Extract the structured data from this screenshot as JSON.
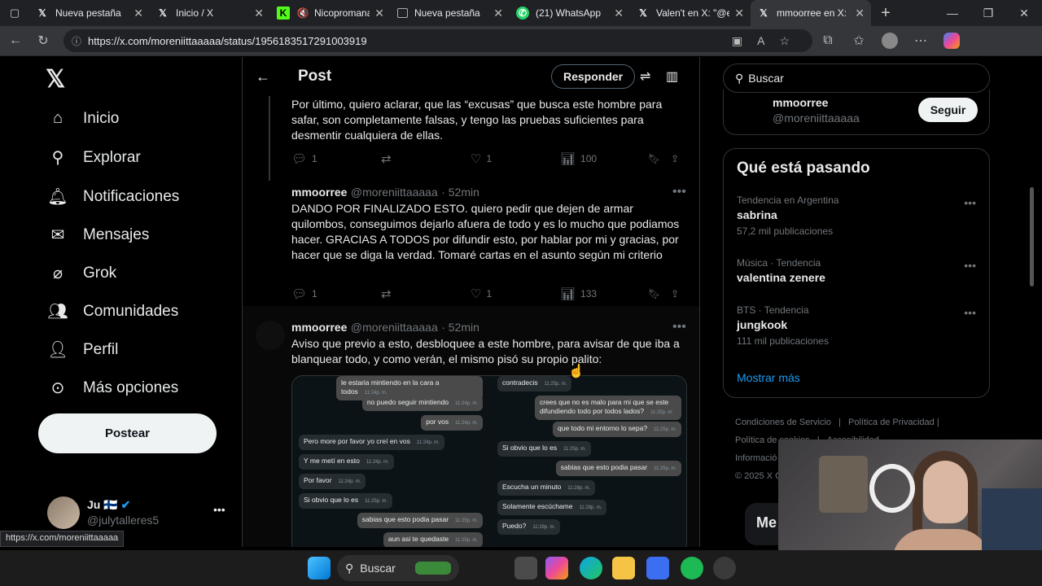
{
  "browser": {
    "tabs": [
      {
        "icon": "x-logo-icon",
        "title": "Nueva pestaña"
      },
      {
        "icon": "x-logo-icon",
        "title": "Inicio / X"
      },
      {
        "icon": "kick-logo-icon",
        "title": "Nicopromana"
      },
      {
        "icon": "tab-icon",
        "title": "Nueva pestaña"
      },
      {
        "icon": "whatsapp-icon",
        "title": "(21) WhatsApp"
      },
      {
        "icon": "x-logo-icon",
        "title": "Valen't en X: \"@e"
      },
      {
        "icon": "x-logo-icon",
        "title": "mmoorree en X: \""
      }
    ],
    "url": "https://x.com/moreniittaaaaa/status/1956183517291003919",
    "status_url": "https://x.com/moreniittaaaaa"
  },
  "sidebar": {
    "items": [
      {
        "label": "Inicio",
        "icon": "home-icon"
      },
      {
        "label": "Explorar",
        "icon": "search-icon"
      },
      {
        "label": "Notificaciones",
        "icon": "bell-icon"
      },
      {
        "label": "Mensajes",
        "icon": "mail-icon"
      },
      {
        "label": "Grok",
        "icon": "grok-icon"
      },
      {
        "label": "Comunidades",
        "icon": "people-icon"
      },
      {
        "label": "Perfil",
        "icon": "person-icon"
      },
      {
        "label": "Más opciones",
        "icon": "more-icon"
      }
    ],
    "post_button": "Postear",
    "account": {
      "name": "Ju 🇫🇮",
      "handle": "@julytalleres5"
    }
  },
  "main": {
    "title": "Post",
    "reply_button": "Responder",
    "tweets": [
      {
        "text": "Por último, quiero aclarar, que las “excusas” que busca este hombre para safar, son completamente falsas, y tengo las pruebas suficientes para desmentir cualquiera de ellas.",
        "replies": "1",
        "retweets": "",
        "likes": "1",
        "views": "100"
      },
      {
        "name": "mmoorree",
        "handle": "@moreniittaaaaa",
        "time": "· 52min",
        "text": "DANDO POR FINALIZADO ESTO. quiero pedir que dejen de armar quilombos, conseguimos dejarlo afuera de todo y es lo mucho que podiamos hacer. GRACIAS A TODOS por difundir esto, por hablar por mi y gracias, por hacer que se diga la verdad. Tomaré cartas en el asunto según mi criterio",
        "replies": "1",
        "retweets": "",
        "likes": "1",
        "views": "133"
      },
      {
        "name": "mmoorree",
        "handle": "@moreniittaaaaa",
        "time": "· 52min",
        "text": "Aviso que previo a esto, desbloquee a este hombre, para avisar de que iba a blanquear todo, y como verán, el mismo pisó su propio palito:"
      }
    ],
    "chat_left": [
      {
        "text": "le estaria mintiendo en la cara a todos",
        "time": "11:24p. m.",
        "side": "out"
      },
      {
        "text": "no puedo seguir mintiendo",
        "time": "11:24p. m.",
        "side": "out"
      },
      {
        "text": "por vos",
        "time": "11:24p. m.",
        "side": "out"
      },
      {
        "text": "Pero more por favor yo creí en vos",
        "time": "11:24p. m.",
        "side": "in"
      },
      {
        "text": "Y me metí en esto",
        "time": "11:24p. m.",
        "side": "in"
      },
      {
        "text": "Por favor",
        "time": "11:24p. m.",
        "side": "in"
      },
      {
        "text": "Si obvio que lo es",
        "time": "11:25p. m.",
        "side": "in"
      },
      {
        "text": "sabias que esto podia pasar",
        "time": "11:25p. m.",
        "side": "out"
      },
      {
        "text": "aun asi te quedaste",
        "time": "11:25p. m.",
        "side": "out"
      }
    ],
    "chat_right": [
      {
        "text": "contradecis",
        "time": "11:25p. m.",
        "side": "in"
      },
      {
        "text": "crees que no es malo para mi que se este difundiendo todo por todos lados?",
        "time": "11:25p. m.",
        "side": "out"
      },
      {
        "text": "que todo mi entorno lo sepa?",
        "time": "11:25p. m.",
        "side": "out"
      },
      {
        "text": "Si obvio que lo es",
        "time": "11:25p. m.",
        "side": "in"
      },
      {
        "text": "sabias que esto podia pasar",
        "time": "11:25p. m.",
        "side": "out"
      },
      {
        "text": "Escucha un minuto",
        "time": "11:28p. m.",
        "side": "in"
      },
      {
        "text": "Solamente escúchame",
        "time": "11:28p. m.",
        "side": "in"
      },
      {
        "text": "Puedo?",
        "time": "11:28p. m.",
        "side": "in"
      }
    ]
  },
  "right": {
    "search_placeholder": "Buscar",
    "follow_card": {
      "name": "mmoorree",
      "handle": "@moreniittaaaaa",
      "button": "Seguir"
    },
    "trends_title": "Qué está pasando",
    "trends": [
      {
        "context": "Tendencia en Argentina",
        "title": "sabrina",
        "count": "57,2 mil publicaciones"
      },
      {
        "context": "Música · Tendencia",
        "title": "valentina zenere",
        "count": ""
      },
      {
        "context": "BTS · Tendencia",
        "title": "jungkook",
        "count": "111 mil publicaciones"
      }
    ],
    "show_more": "Mostrar más",
    "footer": [
      "Condiciones de Servicio",
      "Política de Privacidad",
      "Política de cookies",
      "Accesibilidad",
      "Informació",
      "© 2025 X C"
    ],
    "messages_label": "Me"
  },
  "taskbar": {
    "search": "Buscar"
  }
}
